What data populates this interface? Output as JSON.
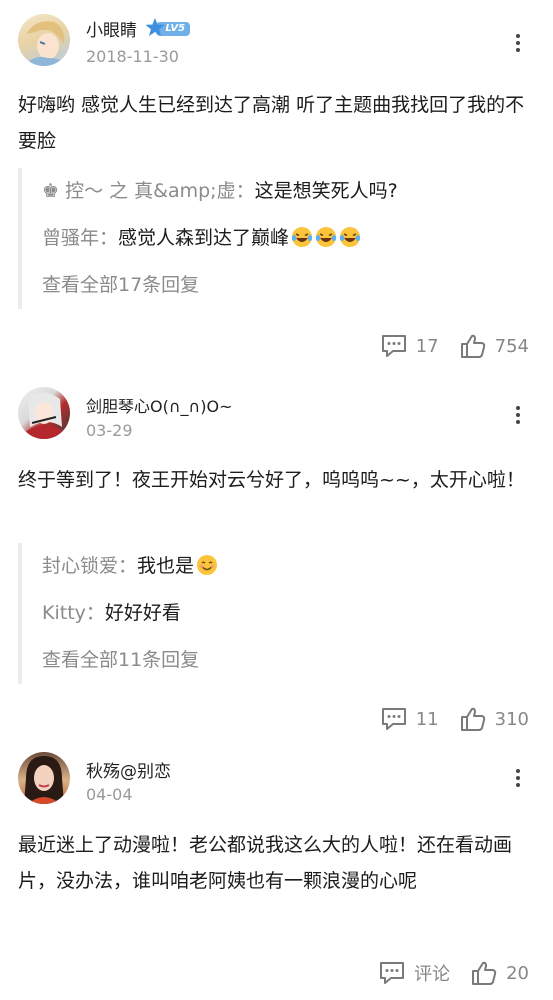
{
  "comments": [
    {
      "username": "小眼睛",
      "badge": "LV5",
      "date": "2018-11-30",
      "content": "好嗨哟 感觉人生已经到达了高潮 听了主题曲我找回了我的不要脸",
      "replies": [
        {
          "name": "♚ 控～ 之 真&amp;虚：",
          "text": "这是想笑死人吗?",
          "emoji_count": 0
        },
        {
          "name": "曾骚年：",
          "text": "感觉人森到达了巅峰",
          "emoji_count": 3
        }
      ],
      "view_all": "查看全部17条回复",
      "reply_count": "17",
      "like_count": "754"
    },
    {
      "username": "剑胆琴心O(∩_∩)O~",
      "date": "03-29",
      "content": "终于等到了！夜王开始对云兮好了，呜呜呜~~，太开心啦！",
      "replies": [
        {
          "name": "封心锁爱：",
          "text": "我也是",
          "emoji_count": 1
        },
        {
          "name": "Kitty：",
          "text": "好好好看",
          "emoji_count": 0
        }
      ],
      "view_all": "查看全部11条回复",
      "reply_count": "11",
      "like_count": "310"
    },
    {
      "username": "秋殇@别恋",
      "date": "04-04",
      "content": "最近迷上了动漫啦！老公都说我这么大的人啦！还在看动画片，没办法，谁叫咱老阿姨也有一颗浪漫的心呢",
      "reply_label": "评论",
      "like_count": "20"
    }
  ],
  "colors": {
    "meta": "#9a9a9a",
    "badge": "#6fb0e8",
    "badge_star": "#3d8fe0"
  }
}
